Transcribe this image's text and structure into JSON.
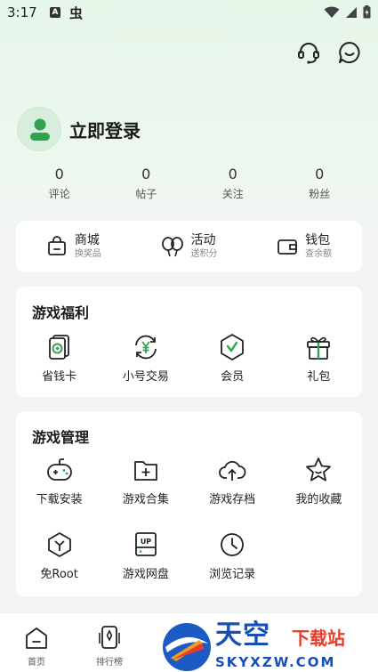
{
  "status_bar": {
    "time": "3:17",
    "notification_a": "A",
    "notification_bug": "虫"
  },
  "profile": {
    "login_label": "立即登录"
  },
  "stats": [
    {
      "value": "0",
      "label": "评论"
    },
    {
      "value": "0",
      "label": "帖子"
    },
    {
      "value": "0",
      "label": "关注"
    },
    {
      "value": "0",
      "label": "粉丝"
    }
  ],
  "quick_links": [
    {
      "title": "商城",
      "subtitle": "换奖品",
      "icon": "shopping-bag-icon"
    },
    {
      "title": "活动",
      "subtitle": "送积分",
      "icon": "balloons-icon"
    },
    {
      "title": "钱包",
      "subtitle": "查余额",
      "icon": "wallet-icon"
    }
  ],
  "game_welfare": {
    "title": "游戏福利",
    "items": [
      {
        "label": "省钱卡",
        "icon": "savings-card-icon"
      },
      {
        "label": "小号交易",
        "icon": "yuan-exchange-icon"
      },
      {
        "label": "会员",
        "icon": "vip-badge-icon"
      },
      {
        "label": "礼包",
        "icon": "gift-icon"
      }
    ]
  },
  "game_management": {
    "title": "游戏管理",
    "items": [
      {
        "label": "下载安装",
        "icon": "gamepad-icon"
      },
      {
        "label": "游戏合集",
        "icon": "folder-plus-icon"
      },
      {
        "label": "游戏存档",
        "icon": "cloud-upload-icon"
      },
      {
        "label": "我的收藏",
        "icon": "star-icon"
      },
      {
        "label": "免Root",
        "icon": "root-free-icon"
      },
      {
        "label": "游戏网盘",
        "icon": "cloud-drive-icon"
      },
      {
        "label": "浏览记录",
        "icon": "clock-icon"
      }
    ]
  },
  "bottom_nav": [
    {
      "label": "首页",
      "icon": "home-icon"
    },
    {
      "label": "排行榜",
      "icon": "ranking-icon"
    }
  ],
  "watermark": {
    "brand": "天空",
    "tag": "下载站",
    "url": "SKYXZW.COM"
  },
  "colors": {
    "accent": "#2ea24f",
    "brand_blue": "#1550b8",
    "brand_red": "#e83c2a"
  }
}
